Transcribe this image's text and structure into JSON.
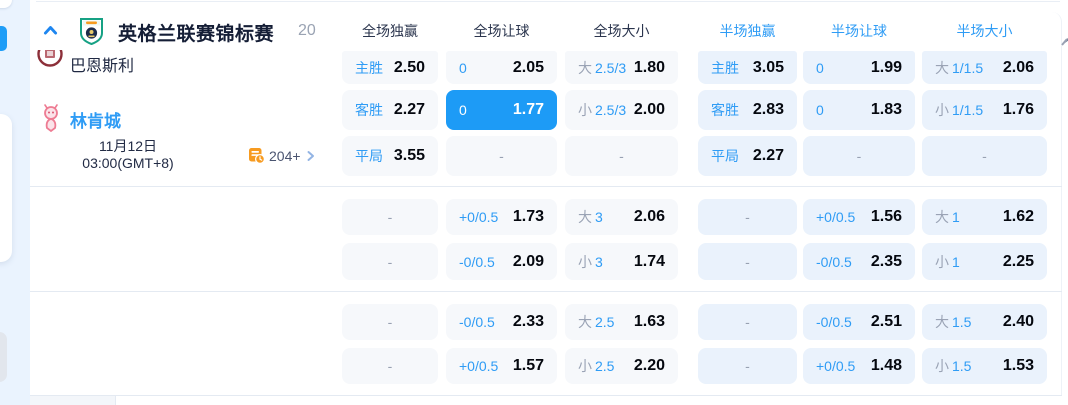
{
  "league": {
    "name": "英格兰联赛锦标赛",
    "count": "20"
  },
  "columns": [
    {
      "label": "全场独赢",
      "scope": "full"
    },
    {
      "label": "全场让球",
      "scope": "full"
    },
    {
      "label": "全场大小",
      "scope": "full"
    },
    {
      "label": "半场独赢",
      "scope": "half"
    },
    {
      "label": "半场让球",
      "scope": "half"
    },
    {
      "label": "半场大小",
      "scope": "half"
    }
  ],
  "match": {
    "home": "巴恩斯利",
    "away": "林肯城",
    "date_line1": "11月12日",
    "date_line2": "03:00(GMT+8)",
    "more_count": "204+"
  },
  "dash_char": "-",
  "odds_rows": [
    [
      {
        "label": "主胜",
        "value": "2.50"
      },
      {
        "label": "0",
        "value": "2.05"
      },
      {
        "prefix": "大",
        "line": "2.5/3",
        "value": "1.80"
      },
      {
        "label": "主胜",
        "value": "3.05"
      },
      {
        "label": "0",
        "value": "1.99"
      },
      {
        "prefix": "大",
        "line": "1/1.5",
        "value": "2.06"
      }
    ],
    [
      {
        "label": "客胜",
        "value": "2.27"
      },
      {
        "label": "0",
        "value": "1.77",
        "selected": true
      },
      {
        "prefix": "小",
        "line": "2.5/3",
        "value": "2.00"
      },
      {
        "label": "客胜",
        "value": "2.83"
      },
      {
        "label": "0",
        "value": "1.83"
      },
      {
        "prefix": "小",
        "line": "1/1.5",
        "value": "1.76"
      }
    ],
    [
      {
        "label": "平局",
        "value": "3.55"
      },
      {
        "dash": true
      },
      {
        "dash": true
      },
      {
        "label": "平局",
        "value": "2.27"
      },
      {
        "dash": true
      },
      {
        "dash": true
      }
    ],
    [
      {
        "dash": true
      },
      {
        "label": "+0/0.5",
        "value": "1.73"
      },
      {
        "prefix": "大",
        "line": "3",
        "value": "2.06"
      },
      {
        "dash": true
      },
      {
        "label": "+0/0.5",
        "value": "1.56"
      },
      {
        "prefix": "大",
        "line": "1",
        "value": "1.62"
      }
    ],
    [
      {
        "dash": true
      },
      {
        "label": "-0/0.5",
        "value": "2.09"
      },
      {
        "prefix": "小",
        "line": "3",
        "value": "1.74"
      },
      {
        "dash": true
      },
      {
        "label": "-0/0.5",
        "value": "2.35"
      },
      {
        "prefix": "小",
        "line": "1",
        "value": "2.25"
      }
    ],
    [
      {
        "dash": true
      },
      {
        "label": "-0/0.5",
        "value": "2.33"
      },
      {
        "prefix": "大",
        "line": "2.5",
        "value": "1.63"
      },
      {
        "dash": true
      },
      {
        "label": "-0/0.5",
        "value": "2.51"
      },
      {
        "prefix": "大",
        "line": "1.5",
        "value": "2.40"
      }
    ],
    [
      {
        "dash": true
      },
      {
        "label": "+0/0.5",
        "value": "1.57"
      },
      {
        "prefix": "小",
        "line": "2.5",
        "value": "2.20"
      },
      {
        "dash": true
      },
      {
        "label": "+0/0.5",
        "value": "1.48"
      },
      {
        "prefix": "小",
        "line": "1.5",
        "value": "1.53"
      }
    ]
  ],
  "colors": {
    "accent_blue": "#2f9cf5",
    "selected_cell": "#1d9bf6",
    "orange": "#f79b20",
    "full_cell_bg": "#f6f8fb",
    "half_cell_bg": "#eaf2fc"
  }
}
